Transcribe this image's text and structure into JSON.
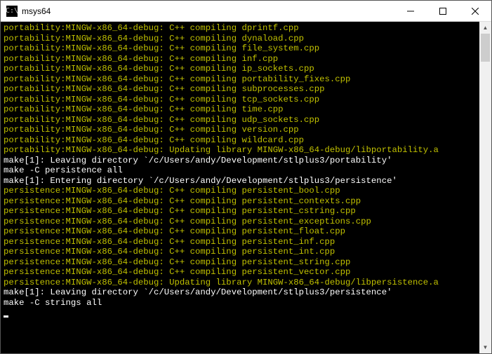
{
  "window": {
    "title": "msys64",
    "icon_glyph": "C:\\"
  },
  "colors": {
    "terminal_bg": "#000000",
    "normal_fg": "#ffffff",
    "highlight_fg": "#c0c000"
  },
  "terminal": {
    "lines": [
      {
        "text": "portability:MINGW-x86_64-debug: C++ compiling dprintf.cpp",
        "style": "yellow"
      },
      {
        "text": "portability:MINGW-x86_64-debug: C++ compiling dynaload.cpp",
        "style": "yellow"
      },
      {
        "text": "portability:MINGW-x86_64-debug: C++ compiling file_system.cpp",
        "style": "yellow"
      },
      {
        "text": "portability:MINGW-x86_64-debug: C++ compiling inf.cpp",
        "style": "yellow"
      },
      {
        "text": "portability:MINGW-x86_64-debug: C++ compiling ip_sockets.cpp",
        "style": "yellow"
      },
      {
        "text": "portability:MINGW-x86_64-debug: C++ compiling portability_fixes.cpp",
        "style": "yellow"
      },
      {
        "text": "portability:MINGW-x86_64-debug: C++ compiling subprocesses.cpp",
        "style": "yellow"
      },
      {
        "text": "portability:MINGW-x86_64-debug: C++ compiling tcp_sockets.cpp",
        "style": "yellow"
      },
      {
        "text": "portability:MINGW-x86_64-debug: C++ compiling time.cpp",
        "style": "yellow"
      },
      {
        "text": "portability:MINGW-x86_64-debug: C++ compiling udp_sockets.cpp",
        "style": "yellow"
      },
      {
        "text": "portability:MINGW-x86_64-debug: C++ compiling version.cpp",
        "style": "yellow"
      },
      {
        "text": "portability:MINGW-x86_64-debug: C++ compiling wildcard.cpp",
        "style": "yellow"
      },
      {
        "text": "portability:MINGW-x86_64-debug: Updating library MINGW-x86_64-debug/libportability.a",
        "style": "yellow"
      },
      {
        "text": "make[1]: Leaving directory `/c/Users/andy/Development/stlplus3/portability'",
        "style": "normal"
      },
      {
        "text": "make -C persistence all",
        "style": "normal"
      },
      {
        "text": "make[1]: Entering directory `/c/Users/andy/Development/stlplus3/persistence'",
        "style": "normal"
      },
      {
        "text": "persistence:MINGW-x86_64-debug: C++ compiling persistent_bool.cpp",
        "style": "yellow"
      },
      {
        "text": "persistence:MINGW-x86_64-debug: C++ compiling persistent_contexts.cpp",
        "style": "yellow"
      },
      {
        "text": "persistence:MINGW-x86_64-debug: C++ compiling persistent_cstring.cpp",
        "style": "yellow"
      },
      {
        "text": "persistence:MINGW-x86_64-debug: C++ compiling persistent_exceptions.cpp",
        "style": "yellow"
      },
      {
        "text": "persistence:MINGW-x86_64-debug: C++ compiling persistent_float.cpp",
        "style": "yellow"
      },
      {
        "text": "persistence:MINGW-x86_64-debug: C++ compiling persistent_inf.cpp",
        "style": "yellow"
      },
      {
        "text": "persistence:MINGW-x86_64-debug: C++ compiling persistent_int.cpp",
        "style": "yellow"
      },
      {
        "text": "persistence:MINGW-x86_64-debug: C++ compiling persistent_string.cpp",
        "style": "yellow"
      },
      {
        "text": "persistence:MINGW-x86_64-debug: C++ compiling persistent_vector.cpp",
        "style": "yellow"
      },
      {
        "text": "persistence:MINGW-x86_64-debug: Updating library MINGW-x86_64-debug/libpersistence.a",
        "style": "yellow"
      },
      {
        "text": "make[1]: Leaving directory `/c/Users/andy/Development/stlplus3/persistence'",
        "style": "normal"
      },
      {
        "text": "make -C strings all",
        "style": "normal"
      }
    ]
  }
}
